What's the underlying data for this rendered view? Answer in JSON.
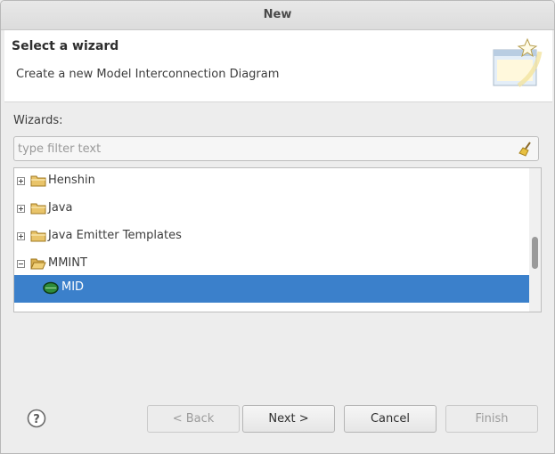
{
  "window": {
    "title": "New"
  },
  "header": {
    "title": "Select a wizard",
    "description": "Create a new Model Interconnection Diagram"
  },
  "wizards_label": "Wizards:",
  "filter": {
    "placeholder": "type filter text",
    "value": ""
  },
  "tree": {
    "items": [
      {
        "label": "Henshin",
        "expanded": false,
        "icon": "folder-icon"
      },
      {
        "label": "Java",
        "expanded": false,
        "icon": "folder-icon"
      },
      {
        "label": "Java Emitter Templates",
        "expanded": false,
        "icon": "folder-icon"
      },
      {
        "label": "MMINT",
        "expanded": true,
        "icon": "folder-icon"
      },
      {
        "label": "MID",
        "selected": true,
        "icon": "mid-leaf-icon"
      }
    ]
  },
  "buttons": {
    "back": "< Back",
    "next": "Next >",
    "cancel": "Cancel",
    "finish": "Finish"
  },
  "colors": {
    "selection": "#3b80cb"
  }
}
